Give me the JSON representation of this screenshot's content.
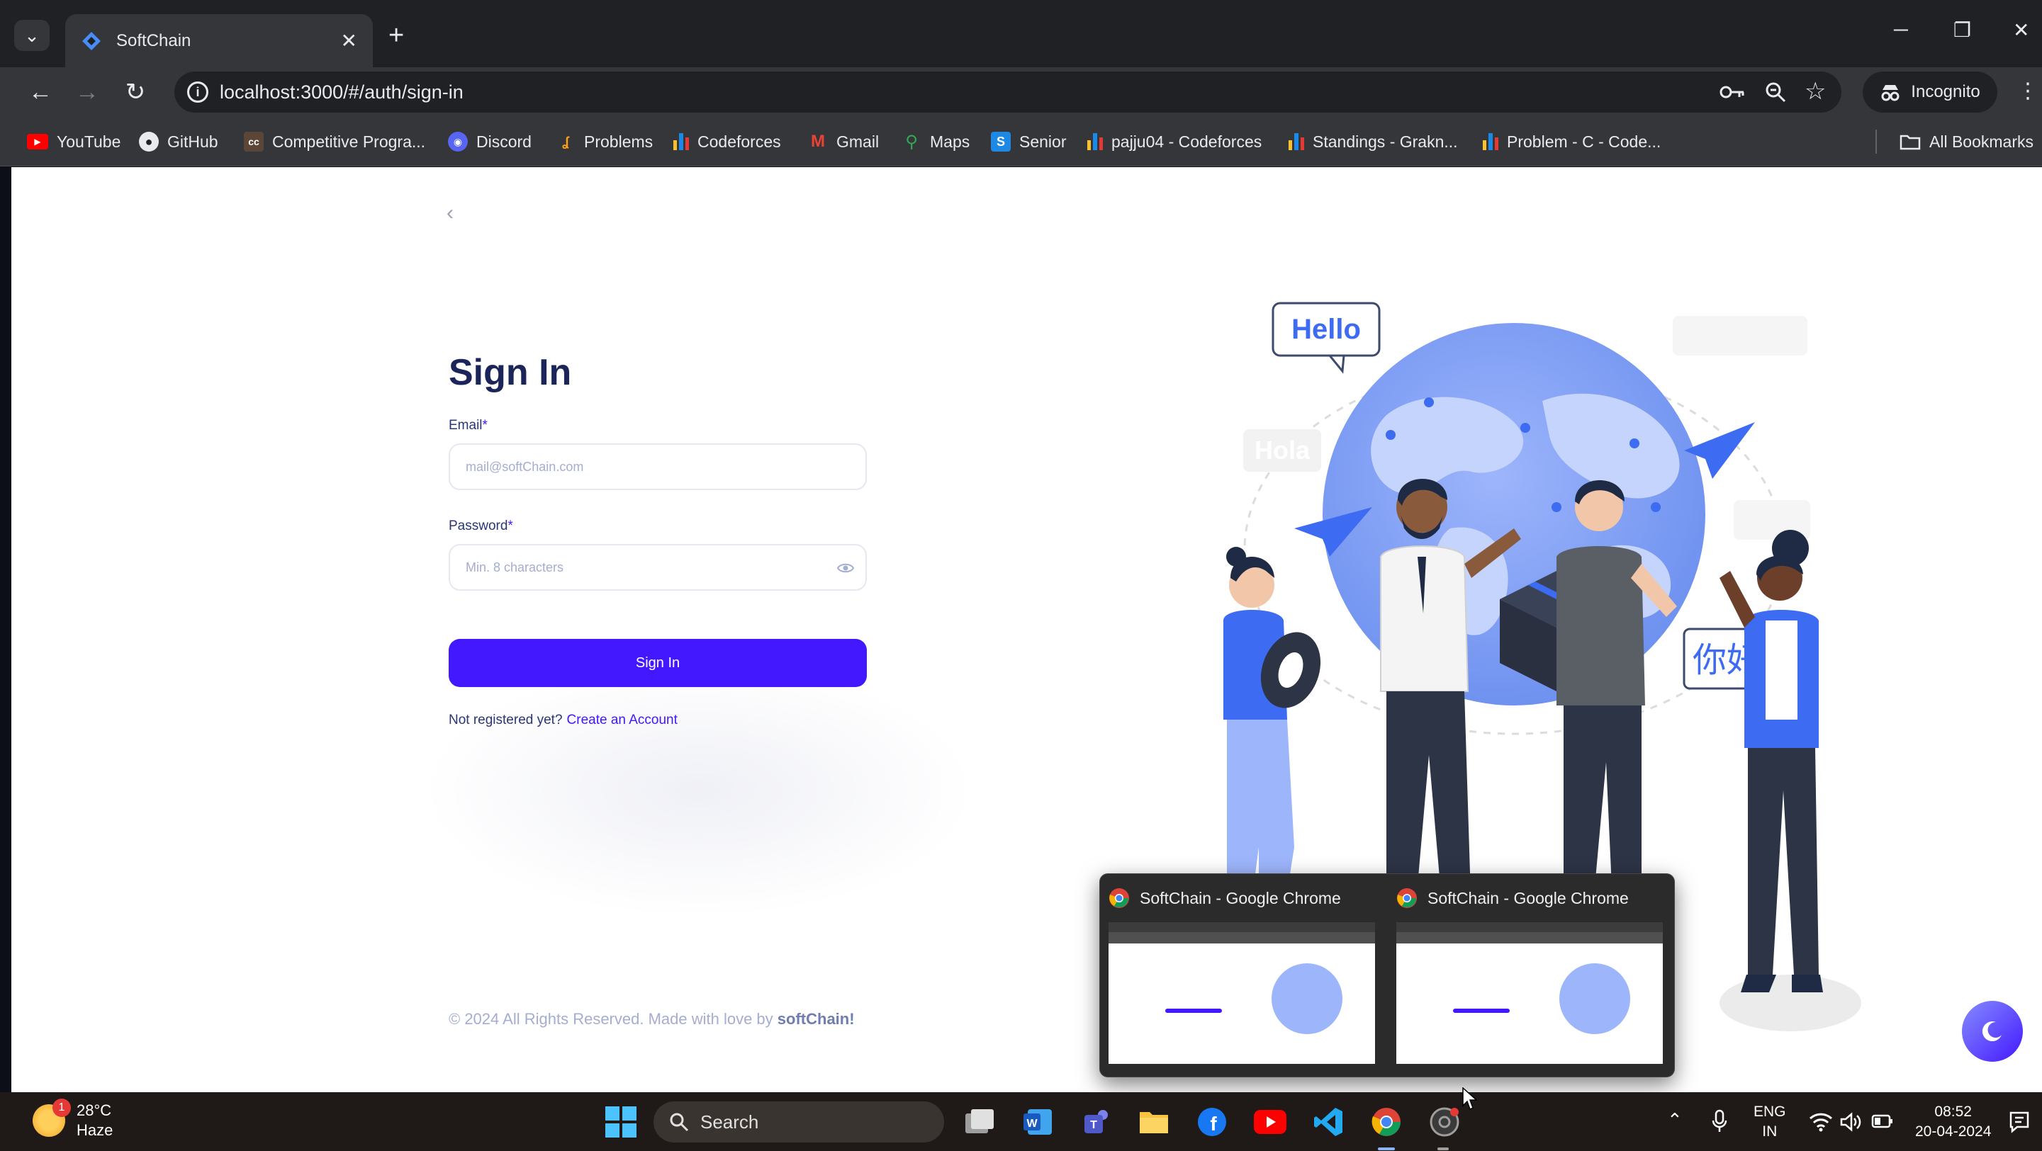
{
  "browser": {
    "tab_title": "SoftChain",
    "url": "localhost:3000/#/auth/sign-in",
    "incognito_label": "Incognito",
    "all_bookmarks": "All Bookmarks",
    "bookmarks": [
      {
        "label": "YouTube",
        "icon": "youtube-icon"
      },
      {
        "label": "GitHub",
        "icon": "github-icon"
      },
      {
        "label": "Competitive Progra...",
        "icon": "codechef-icon"
      },
      {
        "label": "Discord",
        "icon": "discord-icon"
      },
      {
        "label": "Problems",
        "icon": "leetcode-icon"
      },
      {
        "label": "Codeforces",
        "icon": "codeforces-icon"
      },
      {
        "label": "Gmail",
        "icon": "gmail-icon"
      },
      {
        "label": "Maps",
        "icon": "maps-icon"
      },
      {
        "label": "Senior",
        "icon": "s-icon"
      },
      {
        "label": "pajju04 - Codeforces",
        "icon": "codeforces-icon"
      },
      {
        "label": "Standings - Grakn...",
        "icon": "codeforces-icon"
      },
      {
        "label": "Problem - C - Code...",
        "icon": "codeforces-icon"
      }
    ]
  },
  "signin": {
    "title": "Sign In",
    "email_label": "Email",
    "email_placeholder": "mail@softChain.com",
    "password_label": "Password",
    "password_placeholder": "Min. 8 characters",
    "required_mark": "*",
    "button_label": "Sign In",
    "not_registered": "Not registered yet?",
    "create_account": "Create an Account",
    "footer_prefix": "© 2024 All Rights Reserved. Made with love by",
    "footer_brand": "softChain!"
  },
  "illustration": {
    "bubble_hello": "Hello",
    "bubble_hola": "Hola",
    "bubble_nihao": "你好"
  },
  "preview": {
    "items": [
      {
        "title": "SoftChain - Google Chrome"
      },
      {
        "title": "SoftChain - Google Chrome"
      }
    ]
  },
  "taskbar": {
    "temperature": "28°C",
    "weather": "Haze",
    "weather_badge": "1",
    "search_label": "Search",
    "lang_top": "ENG",
    "lang_bottom": "IN",
    "time": "08:52",
    "date": "20-04-2024"
  },
  "colors": {
    "primary": "#4318ff",
    "heading": "#1b2559",
    "muted": "#a3aed0",
    "globe": "#7b9cf5"
  }
}
